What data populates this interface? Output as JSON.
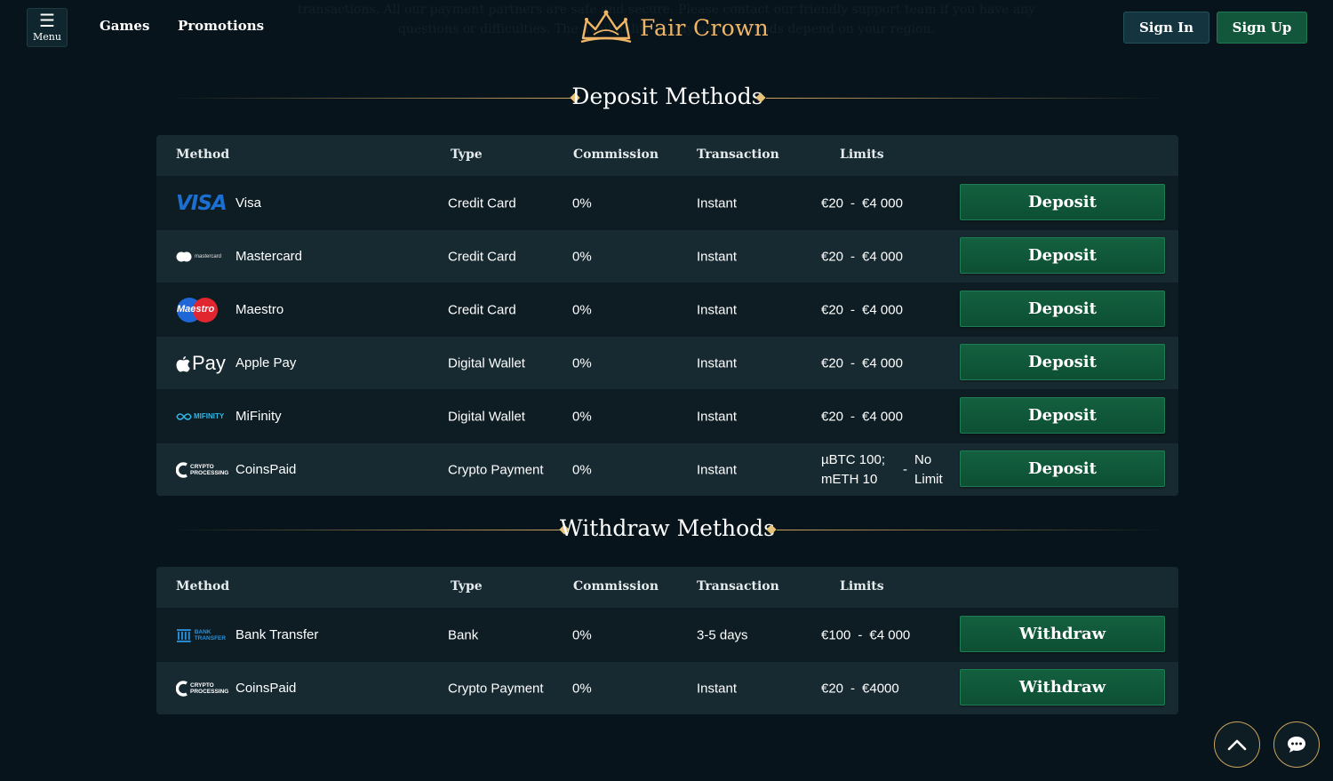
{
  "header": {
    "menu_label": "Menu",
    "nav": [
      "Games",
      "Promotions"
    ],
    "brand": "Fair Crown",
    "signin_label": "Sign In",
    "signup_label": "Sign Up",
    "ghost_text_1": "transactions. All our payment partners are safe and secure. Please contact our friendly support team if you have any",
    "ghost_text_2": "questions or difficulties. The availability of payment methods depend on your region."
  },
  "deposit": {
    "title": "Deposit Methods",
    "columns": [
      "Method",
      "Type",
      "Commission",
      "Transaction",
      "Limits"
    ],
    "button_label": "Deposit",
    "rows": [
      {
        "logo": "VISA",
        "name": "Visa",
        "type": "Credit Card",
        "commission": "0%",
        "transaction": "Instant",
        "limit_min": "€20",
        "limit_max": "€4 000"
      },
      {
        "logo": "mastercard",
        "name": "Mastercard",
        "type": "Credit Card",
        "commission": "0%",
        "transaction": "Instant",
        "limit_min": "€20",
        "limit_max": "€4 000"
      },
      {
        "logo": "Maestro",
        "name": "Maestro",
        "type": "Credit Card",
        "commission": "0%",
        "transaction": "Instant",
        "limit_min": "€20",
        "limit_max": "€4 000"
      },
      {
        "logo": "Pay",
        "name": "Apple Pay",
        "type": "Digital Wallet",
        "commission": "0%",
        "transaction": "Instant",
        "limit_min": "€20",
        "limit_max": "€4 000"
      },
      {
        "logo": "MIFINITY",
        "name": "MiFinity",
        "type": "Digital Wallet",
        "commission": "0%",
        "transaction": "Instant",
        "limit_min": "€20",
        "limit_max": "€4 000"
      },
      {
        "logo": "CRYPTO PROCESSING",
        "name": "CoinsPaid",
        "type": "Crypto Payment",
        "commission": "0%",
        "transaction": "Instant",
        "limit_min_1": "µBTC 100;",
        "limit_min_2": "mETH 10",
        "limit_max_1": "No",
        "limit_max_2": "Limit"
      }
    ]
  },
  "withdraw": {
    "title": "Withdraw Methods",
    "columns": [
      "Method",
      "Type",
      "Commission",
      "Transaction",
      "Limits"
    ],
    "button_label": "Withdraw",
    "rows": [
      {
        "logo": "BANK TRANSFER",
        "name": "Bank Transfer",
        "type": "Bank",
        "commission": "0%",
        "transaction": "3-5 days",
        "limit_min": "€100",
        "limit_max": "€4 000"
      },
      {
        "logo": "CRYPTO PROCESSING",
        "name": "CoinsPaid",
        "type": "Crypto Payment",
        "commission": "0%",
        "transaction": "Instant",
        "limit_min": "€20",
        "limit_max": "€4000"
      }
    ]
  },
  "limit_separator": "-",
  "icons": {
    "menu": "hamburger-icon",
    "crown": "crown-logo-icon",
    "scroll_top": "chevron-up-icon",
    "chat": "chat-bubble-icon"
  },
  "colors": {
    "background": "#07141b",
    "gold": "#e7c27a",
    "button_green": "#13603f",
    "row_dark": "#0e1d23",
    "row_light": "#172a31"
  }
}
